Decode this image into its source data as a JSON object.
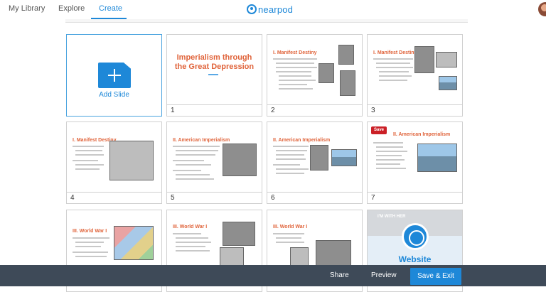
{
  "nav": {
    "tabs": [
      {
        "label": "My Library"
      },
      {
        "label": "Explore"
      },
      {
        "label": "Create",
        "active": true
      }
    ],
    "logo_text": "nearpod"
  },
  "grid": {
    "add_slide_label": "Add Slide",
    "slides": [
      {
        "number": "1",
        "title": "Imperialism through the Great Depression"
      },
      {
        "number": "2",
        "heading": "I. Manifest Destiny"
      },
      {
        "number": "3",
        "heading": "I. Manifest Destiny"
      },
      {
        "number": "4",
        "heading": "I. Manifest Destiny"
      },
      {
        "number": "5",
        "heading": "II. American Imperialism"
      },
      {
        "number": "6",
        "heading": "II. American Imperialism"
      },
      {
        "number": "7",
        "heading": "II. American Imperialism",
        "badge": "Save"
      },
      {
        "heading": "III. World War I"
      },
      {
        "heading": "III. World War I"
      },
      {
        "heading": "III. World War I"
      },
      {
        "type": "website",
        "label": "Website",
        "preview_text": "I'M WITH HER"
      }
    ]
  },
  "footer": {
    "share_label": "Share",
    "preview_label": "Preview",
    "save_exit_label": "Save & Exit"
  },
  "colors": {
    "accent": "#1e88d8",
    "slide_heading": "#e0633a",
    "footer_bg": "#3e4a58",
    "pinterest_red": "#cb2027"
  },
  "icons": [
    "nearpod-logo-icon",
    "plus-file-icon",
    "globe-icon",
    "user-avatar"
  ]
}
